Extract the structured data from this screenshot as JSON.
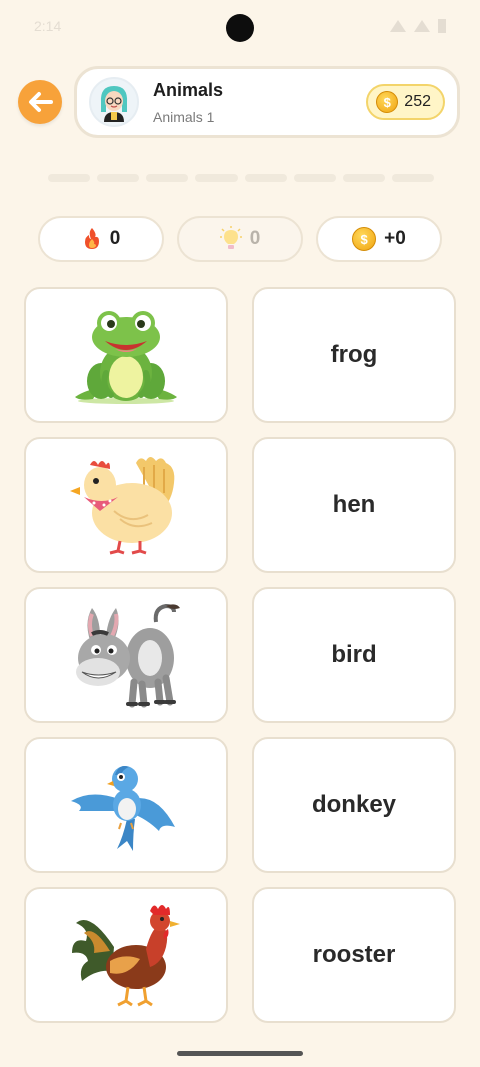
{
  "status_bar": {
    "time": "2:14"
  },
  "header": {
    "title": "Animals",
    "subtitle": "Animals 1",
    "coins": "252"
  },
  "progress": {
    "segments": 8,
    "completed": 0
  },
  "stats": {
    "streak": "0",
    "hints": "0",
    "coins_gained": "+0"
  },
  "image_cards": [
    {
      "icon": "frog-image"
    },
    {
      "icon": "hen-image"
    },
    {
      "icon": "donkey-image"
    },
    {
      "icon": "bird-image"
    },
    {
      "icon": "rooster-image"
    }
  ],
  "word_cards": [
    "frog",
    "hen",
    "bird",
    "donkey",
    "rooster"
  ],
  "colors": {
    "background": "#fcf5e9",
    "accent": "#f7a23a",
    "coin": "#f0a410",
    "card_border": "#e8dfcf"
  }
}
